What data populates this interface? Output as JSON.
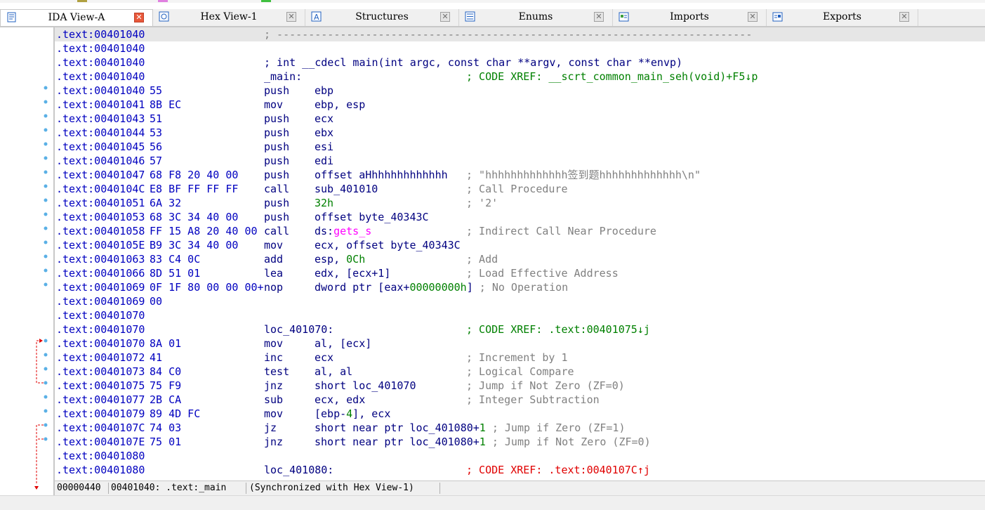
{
  "tabs": [
    {
      "label": "IDA View-A",
      "icon": "disassembly-icon",
      "active": true
    },
    {
      "label": "Hex View-1",
      "icon": "hex-view-icon",
      "active": false
    },
    {
      "label": "Structures",
      "icon": "structures-icon",
      "active": false
    },
    {
      "label": "Enums",
      "icon": "enums-icon",
      "active": false
    },
    {
      "label": "Imports",
      "icon": "imports-icon",
      "active": false
    },
    {
      "label": "Exports",
      "icon": "exports-icon",
      "active": false
    }
  ],
  "tab_close_glyph": "✕",
  "listing": [
    {
      "addr": ".text:00401040",
      "sep": "; ---------------------------------------------------------------------------",
      "sel": true
    },
    {
      "addr": ".text:00401040"
    },
    {
      "addr": ".text:00401040",
      "label": "; int __cdecl main(int argc, const char **argv, const char **envp)"
    },
    {
      "addr": ".text:00401040",
      "label": "_main:",
      "xref": "; CODE XREF: __scrt_common_main_seh(void)+F5↓p"
    },
    {
      "addr": ".text:00401040",
      "bytes": "55",
      "mn": "push",
      "op": "ebp"
    },
    {
      "addr": ".text:00401041",
      "bytes": "8B EC",
      "mn": "mov",
      "op": "ebp, esp"
    },
    {
      "addr": ".text:00401043",
      "bytes": "51",
      "mn": "push",
      "op": "ecx"
    },
    {
      "addr": ".text:00401044",
      "bytes": "53",
      "mn": "push",
      "op": "ebx"
    },
    {
      "addr": ".text:00401045",
      "bytes": "56",
      "mn": "push",
      "op": "esi"
    },
    {
      "addr": ".text:00401046",
      "bytes": "57",
      "mn": "push",
      "op": "edi"
    },
    {
      "addr": ".text:00401047",
      "bytes": "68 F8 20 40 00",
      "mn": "push",
      "op": "offset aHhhhhhhhhhhhh",
      "cm": "; \"hhhhhhhhhhhhh签到题hhhhhhhhhhhhh\\n\""
    },
    {
      "addr": ".text:0040104C",
      "bytes": "E8 BF FF FF FF",
      "mn": "call",
      "op": "sub_401010",
      "cm": "; Call Procedure"
    },
    {
      "addr": ".text:00401051",
      "bytes": "6A 32",
      "mn": "push",
      "num": "32h",
      "cm": "; '2'"
    },
    {
      "addr": ".text:00401053",
      "bytes": "68 3C 34 40 00",
      "mn": "push",
      "op": "offset byte_40343C"
    },
    {
      "addr": ".text:00401058",
      "bytes": "FF 15 A8 20 40 00",
      "mn": "call",
      "op": "ds:",
      "imp": "gets_s",
      "cm": "; Indirect Call Near Procedure"
    },
    {
      "addr": ".text:0040105E",
      "bytes": "B9 3C 34 40 00",
      "mn": "mov",
      "op": "ecx, offset byte_40343C"
    },
    {
      "addr": ".text:00401063",
      "bytes": "83 C4 0C",
      "mn": "add",
      "op": "esp, ",
      "num": "0Ch",
      "cm": "; Add"
    },
    {
      "addr": ".text:00401066",
      "bytes": "8D 51 01",
      "mn": "lea",
      "op": "edx, [ecx+1]",
      "cm": "; Load Effective Address"
    },
    {
      "addr": ".text:00401069",
      "bytes": "0F 1F 80 00 00 00+",
      "mn": "nop",
      "op": "dword ptr [eax+",
      "num": "00000000h",
      "op2": "]",
      "cm": "; No Operation"
    },
    {
      "addr": ".text:00401069",
      "bytes": "00"
    },
    {
      "addr": ".text:00401070"
    },
    {
      "addr": ".text:00401070",
      "label": "loc_401070:",
      "xref": "; CODE XREF: .text:00401075↓j"
    },
    {
      "addr": ".text:00401070",
      "bytes": "8A 01",
      "mn": "mov",
      "op": "al, [ecx]"
    },
    {
      "addr": ".text:00401072",
      "bytes": "41",
      "mn": "inc",
      "op": "ecx",
      "cm": "; Increment by 1"
    },
    {
      "addr": ".text:00401073",
      "bytes": "84 C0",
      "mn": "test",
      "op": "al, al",
      "cm": "; Logical Compare"
    },
    {
      "addr": ".text:00401075",
      "bytes": "75 F9",
      "mn": "jnz",
      "op": "short loc_401070",
      "cm": "; Jump if Not Zero (ZF=0)"
    },
    {
      "addr": ".text:00401077",
      "bytes": "2B CA",
      "mn": "sub",
      "op": "ecx, edx",
      "cm": "; Integer Subtraction"
    },
    {
      "addr": ".text:00401079",
      "bytes": "89 4D FC",
      "mn": "mov",
      "op": "[ebp-",
      "num": "4",
      "op2": "], ecx"
    },
    {
      "addr": ".text:0040107C",
      "bytes": "74 03",
      "mn": "jz",
      "op": "short near ptr loc_401080+",
      "num": "1",
      "cm": "; Jump if Zero (ZF=1)"
    },
    {
      "addr": ".text:0040107E",
      "bytes": "75 01",
      "mn": "jnz",
      "op": "short near ptr loc_401080+",
      "num": "1",
      "cm": "; Jump if Not Zero (ZF=0)"
    },
    {
      "addr": ".text:00401080"
    },
    {
      "addr": ".text:00401080",
      "label": "loc_401080:",
      "xref_red": "; CODE XREF: .text:0040107C↑j"
    }
  ],
  "status": {
    "offset": "00000440",
    "location": "00401040: .text:_main",
    "sync": "(Synchronized with Hex View-1)"
  },
  "colors": {
    "address": "#0000c0",
    "comment": "#808080",
    "xref": "#008000",
    "import": "#ff00ff",
    "flow_arrow": "#e00000",
    "bullet": "#5ab0e6"
  }
}
